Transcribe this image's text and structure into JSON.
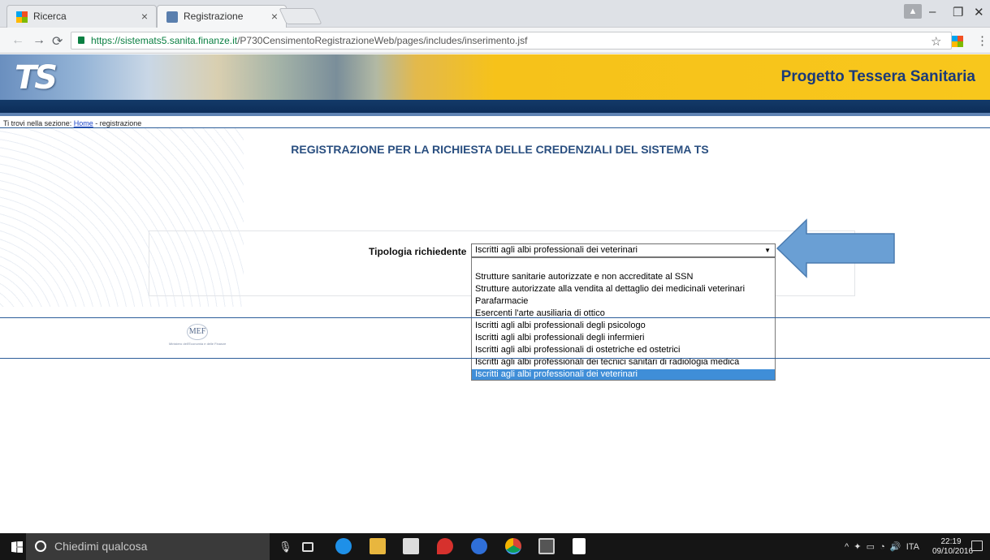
{
  "browser": {
    "tabs": [
      {
        "label": "Ricerca",
        "active": false
      },
      {
        "label": "Registrazione",
        "active": true
      }
    ],
    "tab_close": "×",
    "url_host": "https://sistemats5.sanita.finanze.it",
    "url_path": "/P730CensimentoRegistrazioneWeb/pages/includes/inserimento.jsf",
    "window": {
      "minimize": "–",
      "restore": "❐",
      "close": "✕"
    }
  },
  "banner": {
    "logo": "TS",
    "title": "Progetto Tessera Sanitaria"
  },
  "breadcrumb": {
    "prefix": "Ti trovi nella sezione:",
    "home": "Home",
    "current": " - registrazione"
  },
  "page": {
    "heading": "REGISTRAZIONE PER LA RICHIESTA DELLE CREDENZIALI DEL SISTEMA TS"
  },
  "form": {
    "label": "Tipologia richiedente",
    "selected": "Iscritti agli albi professionali dei veterinari",
    "options": [
      "",
      "Strutture sanitarie autorizzate e non accreditate al SSN",
      "Strutture autorizzate alla vendita al dettaglio dei medicinali veterinari",
      "Parafarmacie",
      "Esercenti l'arte ausiliaria di ottico",
      "Iscritti agli albi professionali degli psicologo",
      "Iscritti agli albi professionali degli infermieri",
      "Iscritti agli albi professionali di ostetriche ed ostetrici",
      "Iscritti agli albi professionali dei tecnici sanitari di radiologia medica",
      "Iscritti agli albi professionali dei veterinari"
    ],
    "highlighted_index": 9
  },
  "footer": {
    "logo": "MEF",
    "logo_sub": "Ministero dell'Economia e delle Finanze"
  },
  "taskbar": {
    "search_placeholder": "Chiedimi qualcosa",
    "language": "ITA",
    "time": "22:19",
    "date": "09/10/2016"
  },
  "colors": {
    "accent": "#2a4f80",
    "banner_yellow": "#f8c71c",
    "selection": "#3f8ed8",
    "arrow": "#6a9fd4"
  }
}
